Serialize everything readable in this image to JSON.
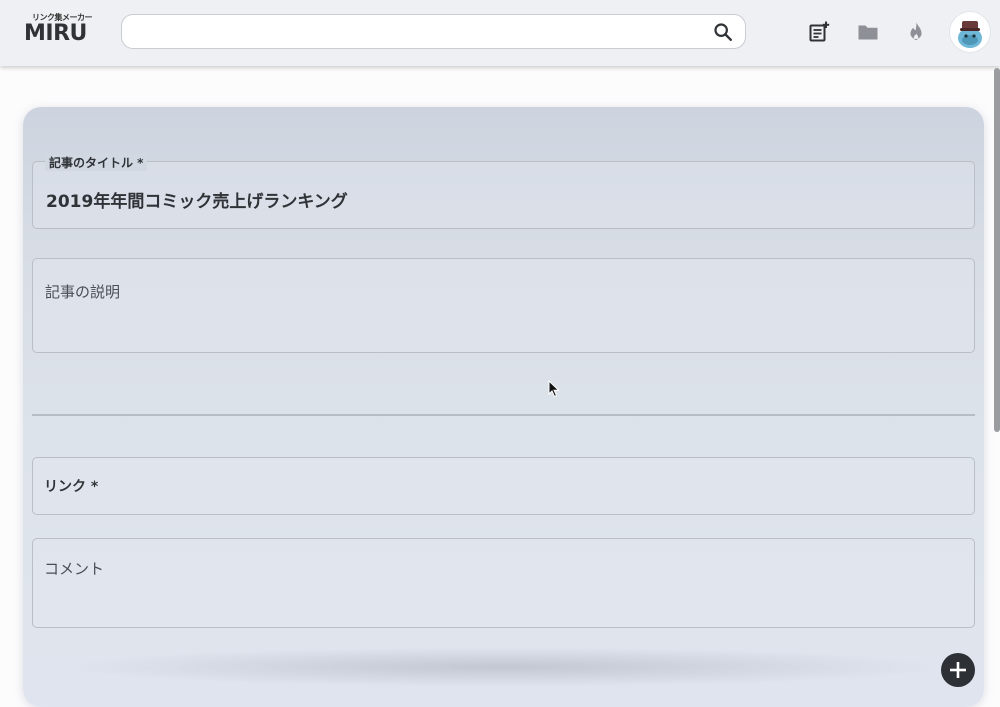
{
  "header": {
    "logo_sub": "リンク集メーカー",
    "logo_main": "MIRU",
    "search": {
      "value": "",
      "placeholder": ""
    },
    "icons": [
      "new-article-icon",
      "folder-icon",
      "fire-icon"
    ]
  },
  "form": {
    "title_label": "記事のタイトル *",
    "title_value": "2019年年間コミック売上げランキング",
    "description_placeholder": "記事の説明",
    "link_label": "リンク *",
    "comment_placeholder": "コメント"
  },
  "colors": {
    "header_bg": "#eef0f3",
    "card_bg": "#d9dee6",
    "text": "#2f3337",
    "add_button": "#2d3136"
  }
}
